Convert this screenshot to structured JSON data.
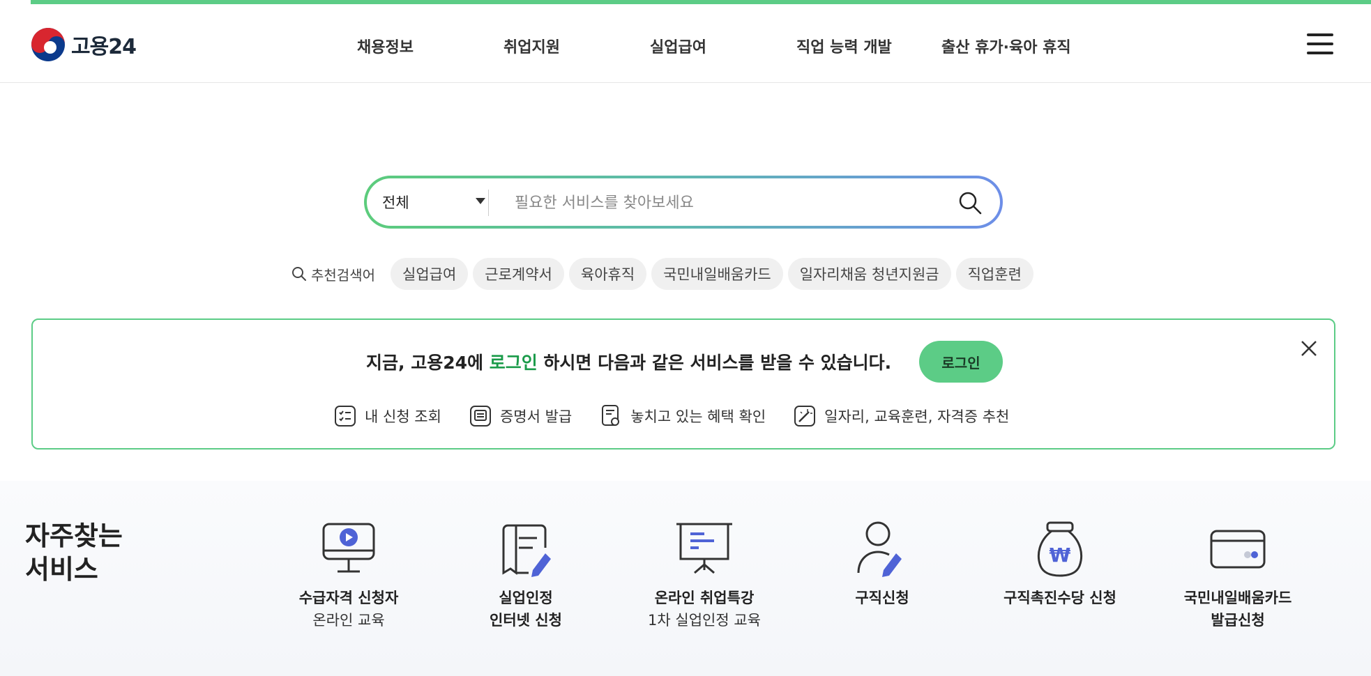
{
  "header": {
    "logo_text": "고용24",
    "nav": [
      "채용정보",
      "취업지원",
      "실업급여",
      "직업 능력 개발",
      "출산 휴가·육아 휴직"
    ]
  },
  "search": {
    "category": "전체",
    "placeholder": "필요한 서비스를 찾아보세요",
    "value": ""
  },
  "recommended": {
    "label": "추천검색어",
    "keywords": [
      "실업급여",
      "근로계약서",
      "육아휴직",
      "국민내일배움카드",
      "일자리채움 청년지원금",
      "직업훈련"
    ]
  },
  "login_banner": {
    "msg_before": "지금, 고용24에 ",
    "msg_highlight": "로그인",
    "msg_after": " 하시면 다음과 같은 서비스를 받을 수 있습니다.",
    "button": "로그인",
    "benefits": [
      "내 신청 조회",
      "증명서 발급",
      "놓치고 있는 혜택 확인",
      "일자리, 교육훈련, 자격증 추천"
    ]
  },
  "frequent": {
    "title_line1": "자주찾는",
    "title_line2": "서비스",
    "services": [
      {
        "l1": "수급자격 신청자",
        "l2": "온라인 교육",
        "icon": "monitor-play-icon"
      },
      {
        "l1": "실업인정",
        "l2": "인터넷 신청",
        "icon": "document-pen-icon"
      },
      {
        "l1": "온라인 취업특강",
        "l2": "1차 실업인정 교육",
        "icon": "presentation-board-icon"
      },
      {
        "l1": "구직신청",
        "l2": "",
        "icon": "person-pen-icon"
      },
      {
        "l1": "구직촉진수당 신청",
        "l2": "",
        "icon": "money-bag-icon"
      },
      {
        "l1": "국민내일배움카드",
        "l2": "발급신청",
        "icon": "card-icon"
      }
    ]
  },
  "colors": {
    "brand_green": "#5ccc86",
    "accent_blue": "#4f63d6"
  }
}
